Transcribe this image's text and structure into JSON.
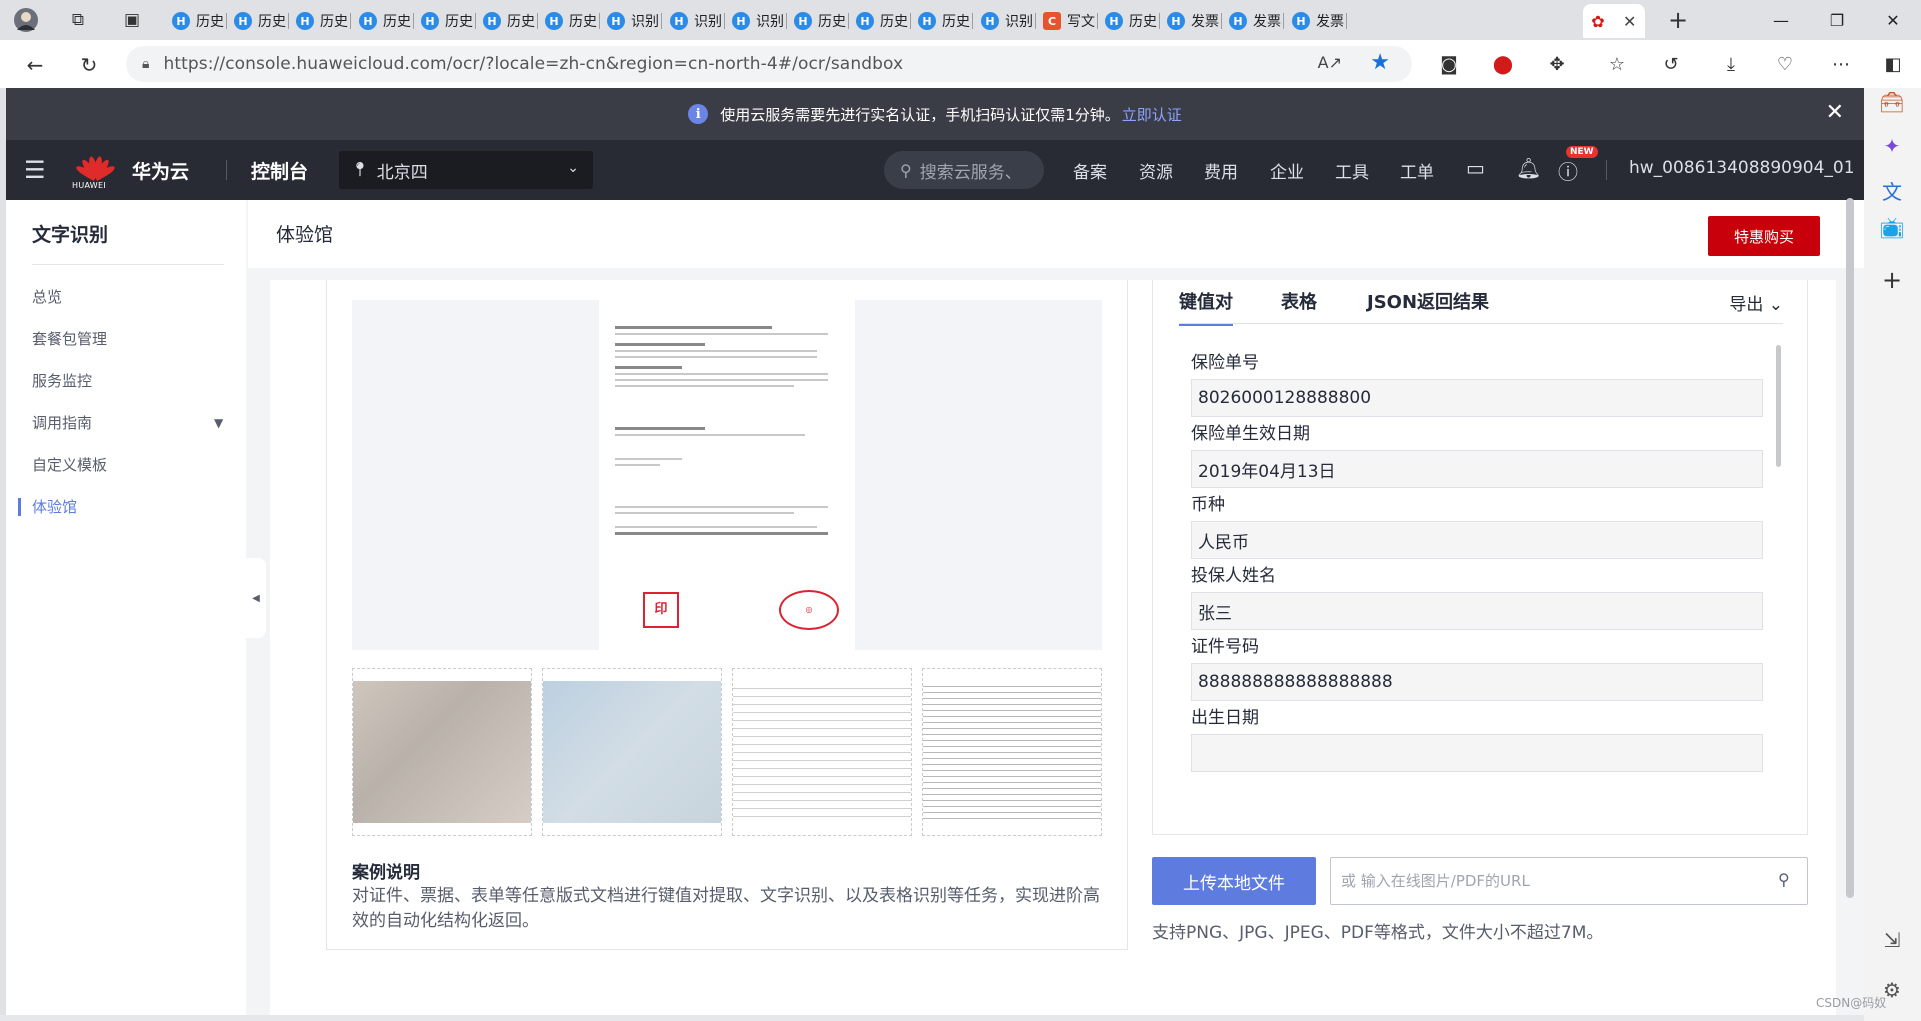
{
  "browser": {
    "tabs": [
      {
        "label": "历史",
        "fav": "H"
      },
      {
        "label": "历史",
        "fav": "H"
      },
      {
        "label": "历史",
        "fav": "H"
      },
      {
        "label": "历史",
        "fav": "H"
      },
      {
        "label": "历史",
        "fav": "H"
      },
      {
        "label": "历史",
        "fav": "H"
      },
      {
        "label": "历史",
        "fav": "H"
      },
      {
        "label": "识别",
        "fav": "H"
      },
      {
        "label": "识别",
        "fav": "H"
      },
      {
        "label": "识别",
        "fav": "H"
      },
      {
        "label": "历史",
        "fav": "H"
      },
      {
        "label": "历史",
        "fav": "H"
      },
      {
        "label": "历史",
        "fav": "H"
      },
      {
        "label": "识别",
        "fav": "H"
      },
      {
        "label": "写文",
        "fav": "C"
      },
      {
        "label": "历史",
        "fav": "H"
      },
      {
        "label": "发票",
        "fav": "H"
      },
      {
        "label": "发票",
        "fav": "H"
      },
      {
        "label": "发票",
        "fav": "H"
      }
    ],
    "url": "https://console.huaweicloud.com/ocr/?locale=zh-cn&region=cn-north-4#/ocr/sandbox"
  },
  "notice": {
    "text": "使用云服务需要先进行实名认证，手机扫码认证仅需1分钟。",
    "link": "立即认证"
  },
  "topnav": {
    "logo_caption": "HUAWEI",
    "brand": "华为云",
    "console": "控制台",
    "region": "北京四",
    "search_placeholder": "搜索云服务、",
    "links": [
      "备案",
      "资源",
      "费用",
      "企业",
      "工具",
      "工单"
    ],
    "new_badge": "NEW",
    "account": "hw_008613408890904_01"
  },
  "sidemenu": {
    "title": "文字识别",
    "items": [
      "总览",
      "套餐包管理",
      "服务监控",
      "调用指南",
      "自定义模板",
      "体验馆"
    ]
  },
  "page": {
    "title": "体验馆",
    "buy_button": "特惠购买"
  },
  "case": {
    "title": "案例说明",
    "desc": "对证件、票据、表单等任意版式文档进行键值对提取、文字识别、以及表格识别等任务，实现进阶高效的自动化结构化返回。"
  },
  "result": {
    "tabs": [
      "键值对",
      "表格",
      "JSON返回结果"
    ],
    "export": "导出",
    "fields": [
      {
        "key": "保险单号",
        "value": "8026000128888800"
      },
      {
        "key": "保险单生效日期",
        "value": "2019年04月13日"
      },
      {
        "key": "币种",
        "value": "人民币"
      },
      {
        "key": "投保人姓名",
        "value": "张三"
      },
      {
        "key": "证件号码",
        "value": "888888888888888888"
      },
      {
        "key": "出生日期",
        "value": ""
      }
    ]
  },
  "upload": {
    "button": "上传本地文件",
    "placeholder": "或 输入在线图片/PDF的URL",
    "support": "支持PNG、JPG、JPEG、PDF等格式，文件大小不超过7M。"
  },
  "watermark": "CSDN@码奴"
}
